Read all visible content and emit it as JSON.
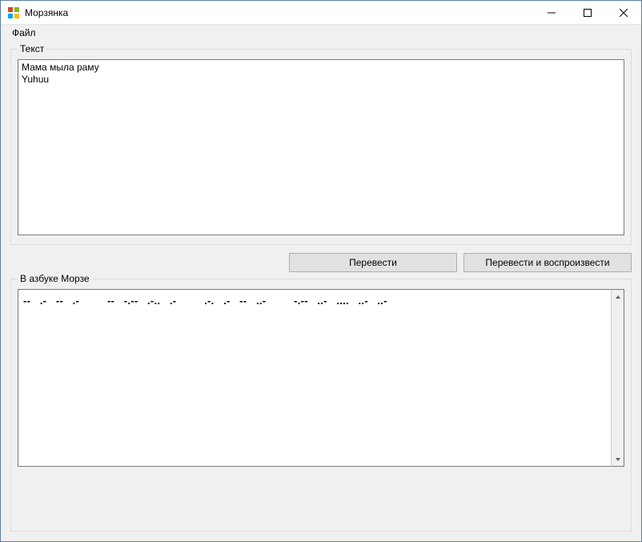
{
  "window": {
    "title": "Морзянка"
  },
  "menu": {
    "file": "Файл"
  },
  "groups": {
    "text_label": "Текст",
    "morse_label": "В азбуке Морзе"
  },
  "input": {
    "value": "Мама мыла раму\nYuhuu"
  },
  "buttons": {
    "translate": "Перевести",
    "translate_play": "Перевести и воспроизвести"
  },
  "output": {
    "value": "--   .-   --   .-         --   -.--   .-..   .-         .-.   .-   --   ..-         -.--   ..-   ....   ..-   ..-"
  }
}
